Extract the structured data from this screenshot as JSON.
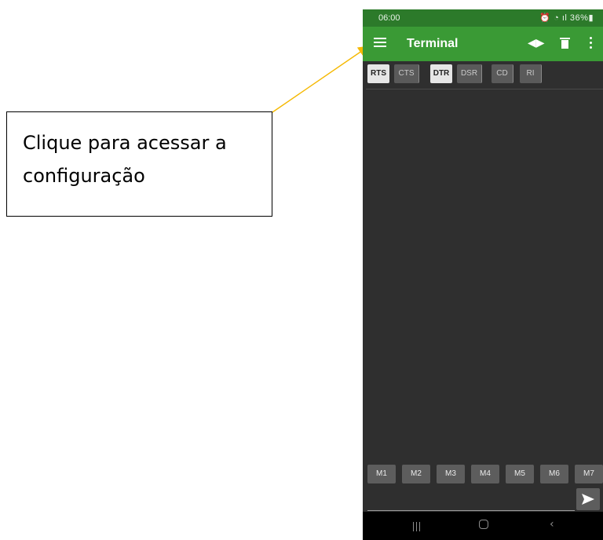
{
  "callout": {
    "line1": "Clique para acessar a",
    "line2": "configuração"
  },
  "status_bar": {
    "time": "06:00",
    "system_icons": "⏰ ◔ ᵛᵒˡᵗᵉ ᵢₗ 36%▮",
    "battery": "36%"
  },
  "app_bar": {
    "title": "Terminal",
    "icons": [
      "menu-icon",
      "connect-icon",
      "trash-icon",
      "more-vert-icon"
    ]
  },
  "control_lines": [
    {
      "label": "RTS",
      "active": true
    },
    {
      "label": "CTS",
      "active": false
    },
    {
      "label": "DTR",
      "active": true
    },
    {
      "label": "DSR",
      "active": false
    },
    {
      "label": "CD",
      "active": false
    },
    {
      "label": "RI",
      "active": false
    }
  ],
  "macros": [
    "M1",
    "M2",
    "M3",
    "M4",
    "M5",
    "M6",
    "M7"
  ],
  "send": {
    "input_value": "",
    "icon": "send-icon"
  },
  "nav_bar": {
    "icons": [
      "recent-apps-icon",
      "home-icon",
      "back-icon"
    ]
  },
  "colors": {
    "status_bar": "#2c7a2a",
    "app_bar": "#3a9a35",
    "background": "#2f2f2f",
    "arrow": "#f5b800"
  }
}
